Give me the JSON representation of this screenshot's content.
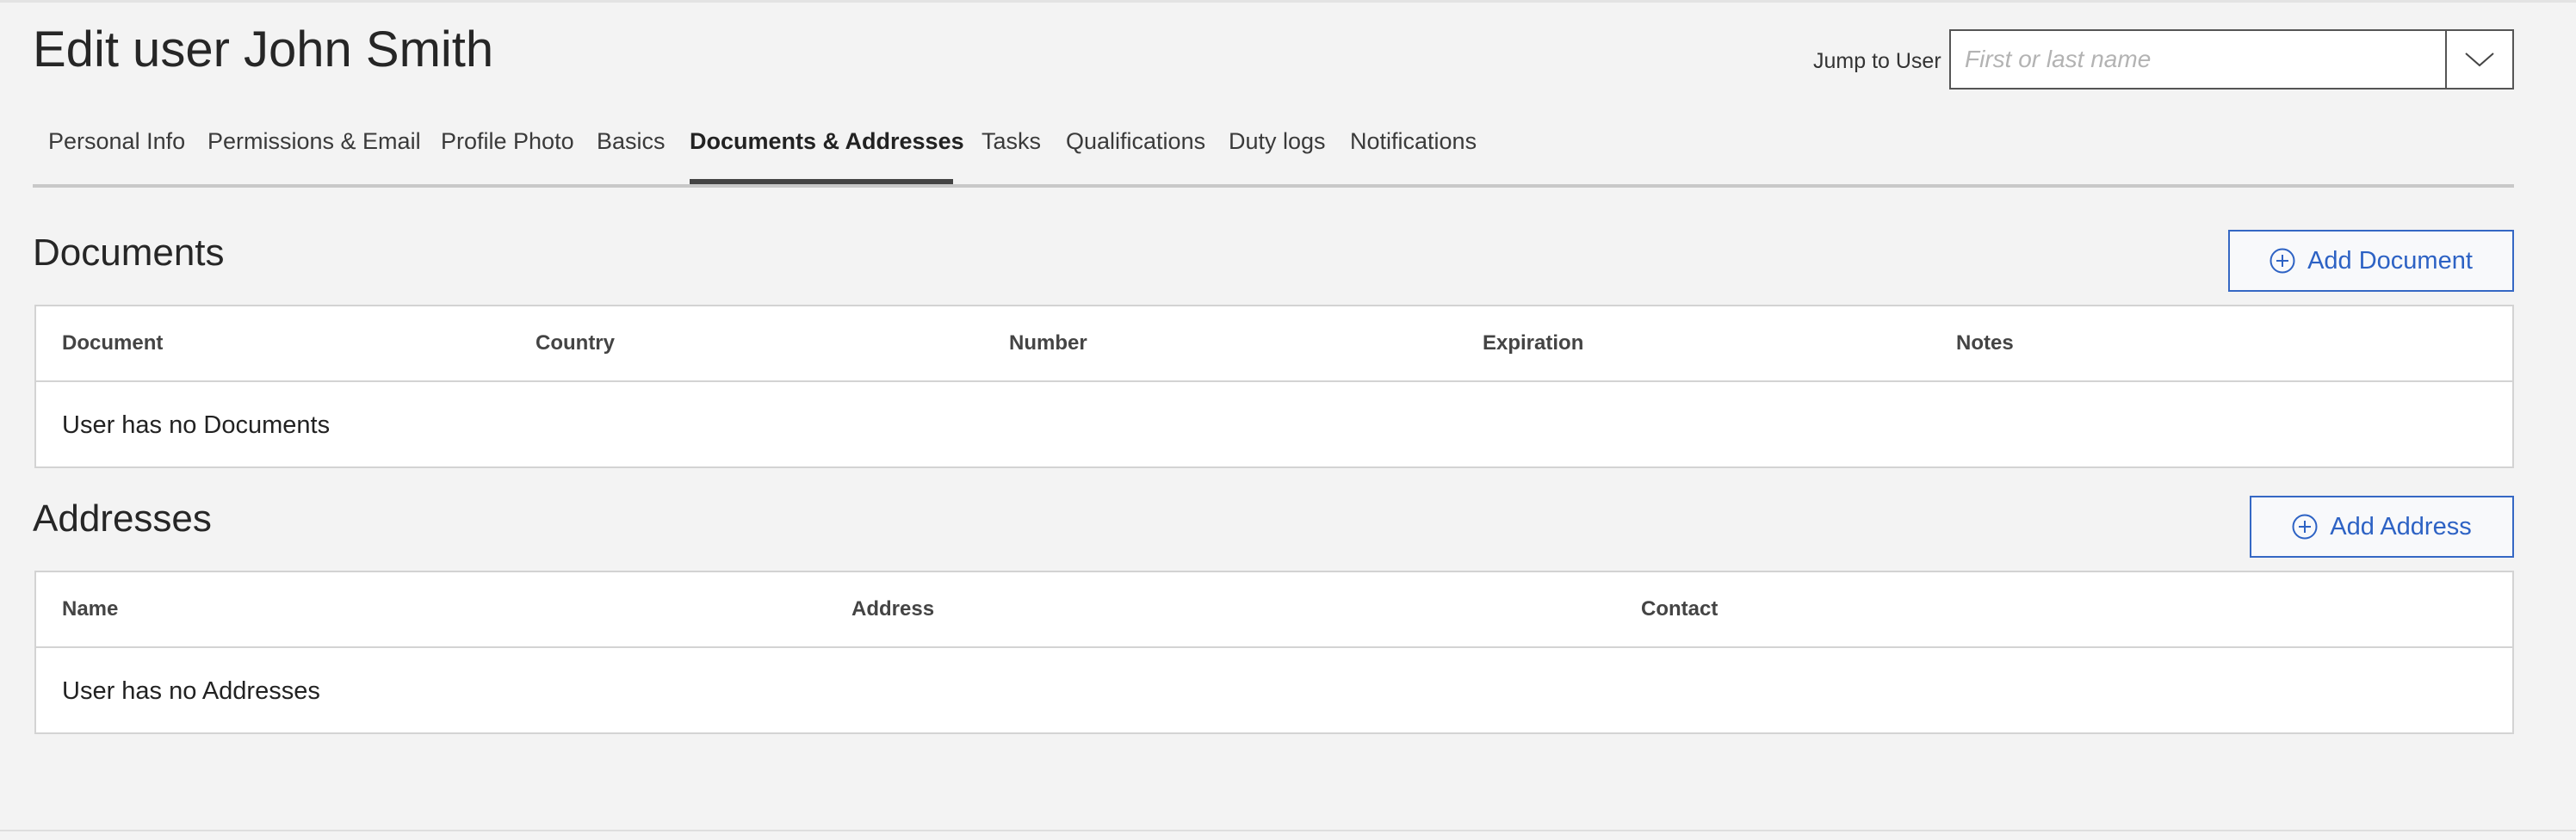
{
  "header": {
    "title": "Edit user John Smith",
    "jump_label": "Jump to User",
    "jump_placeholder": "First or last name"
  },
  "tabs": [
    {
      "label": "Personal Info",
      "active": false
    },
    {
      "label": "Permissions & Email",
      "active": false
    },
    {
      "label": "Profile Photo",
      "active": false
    },
    {
      "label": "Basics",
      "active": false
    },
    {
      "label": "Documents & Addresses",
      "active": true
    },
    {
      "label": "Tasks",
      "active": false
    },
    {
      "label": "Qualifications",
      "active": false
    },
    {
      "label": "Duty logs",
      "active": false
    },
    {
      "label": "Notifications",
      "active": false
    }
  ],
  "documents": {
    "title": "Documents",
    "add_label": "Add Document",
    "columns": [
      "Document",
      "Country",
      "Number",
      "Expiration",
      "Notes"
    ],
    "empty_text": "User has no Documents"
  },
  "addresses": {
    "title": "Addresses",
    "add_label": "Add Address",
    "columns": [
      "Name",
      "Address",
      "Contact"
    ],
    "empty_text": "User has no Addresses"
  },
  "colors": {
    "accent": "#2d62c4",
    "background": "#f3f3f3"
  }
}
